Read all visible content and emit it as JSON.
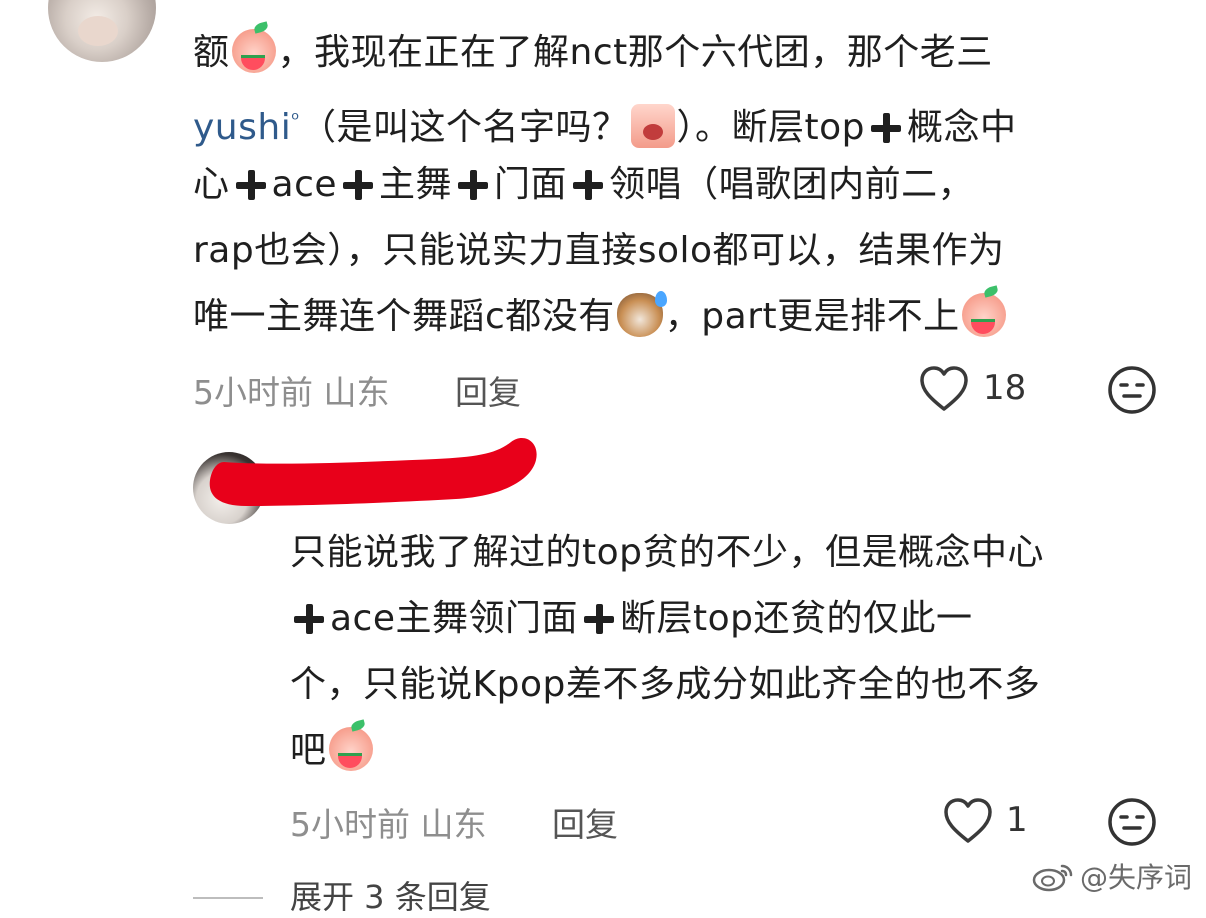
{
  "comment1": {
    "lines": [
      {
        "a": "额",
        "b": "，我现在正在了解nct那个六代团，那个老三"
      },
      {
        "user": "yushi",
        "a": "（是叫这个名字吗？",
        "b": "）。断层top",
        "c": "概念中"
      },
      {
        "a": "心",
        "b": "ace",
        "c": "主舞",
        "d": "门面",
        "e": "领唱（唱歌团内前二，"
      },
      {
        "a": "rap也会），只能说实力直接solo都可以，结果作为"
      },
      {
        "a": "唯一主舞连个舞蹈c都没有",
        "b": "，part更是排不上"
      }
    ],
    "time": "5小时前",
    "location": "山东",
    "reply_label": "回复",
    "likes": "18"
  },
  "comment2": {
    "lines": [
      {
        "a": "只能说我了解过的top贫的不少，但是概念中心"
      },
      {
        "a": "ace主舞领门面",
        "b": "断层top还贫的仅此一"
      },
      {
        "a": "个，只能说Kpop差不多成分如此齐全的也不多"
      },
      {
        "a": "吧"
      }
    ],
    "time": "5小时前",
    "location": "山东",
    "reply_label": "回复",
    "likes": "1"
  },
  "expand_replies": "展开 3 条回复",
  "watermark": "@失序词",
  "colors": {
    "link": "#2f5a8b",
    "redaction": "#e8001a",
    "meta": "#8e8e8e"
  }
}
